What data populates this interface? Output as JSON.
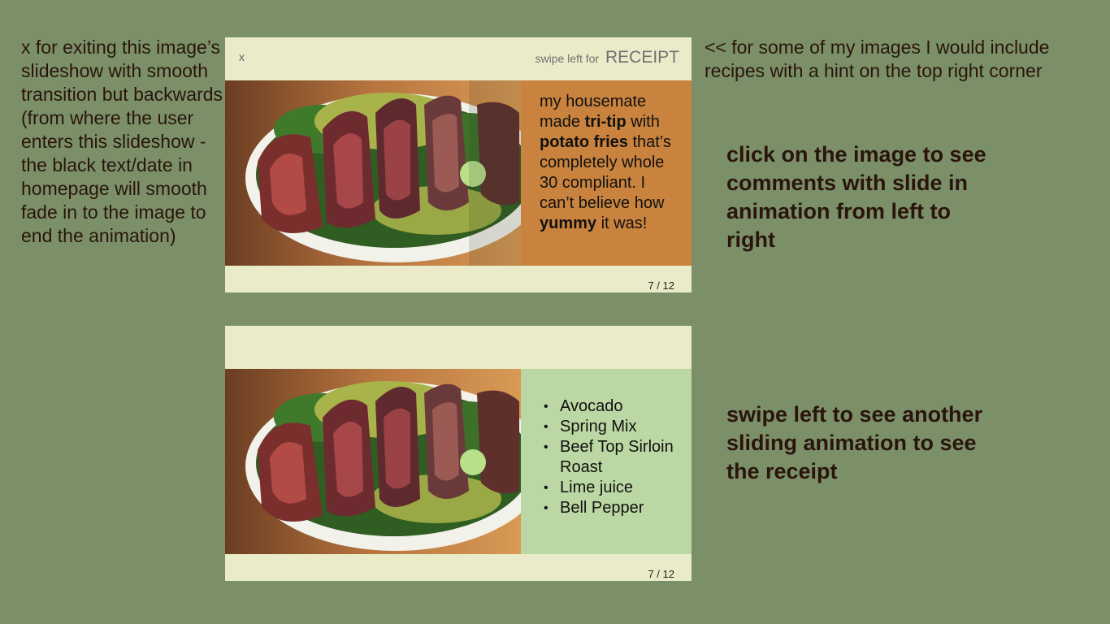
{
  "annotations": {
    "exit_note": "x for exiting this image’s slideshow with smooth transition but backwards (from where the user enters this slideshow - the black text/date in homepage will smooth fade in to the image to end the animation)",
    "recipe_hint_note": "<< for some of my images I would include recipes with a hint on the top right corner",
    "comments_note": "click on the image to see comments with slide in animation from left to right",
    "swipe_note": "swipe left to see another sliding animation to see the receipt"
  },
  "slide_comments": {
    "close_label": "x",
    "hint_prefix": "swipe left for",
    "hint_word": "RECEIPT",
    "comment": {
      "p1": "my housemate made ",
      "b1": "tri-tip",
      "p2": " with ",
      "b2": "potato fries",
      "p3": " that’s completely whole 30 compliant. I can’t believe how ",
      "b3": "yummy",
      "p4": " it was!"
    },
    "counter": "7 / 12"
  },
  "slide_recipe": {
    "ingredients": [
      "Avocado",
      "Spring Mix",
      "Beef Top Sirloin Roast",
      "Lime juice",
      "Bell Pepper"
    ],
    "bullet": "•",
    "counter": "7 / 12"
  },
  "colors": {
    "background": "#7b9068",
    "card": "#eaecc9",
    "comment_panel": "#c9833e",
    "recipe_panel": "#bbd7a3",
    "annotation_text": "#2a140d"
  },
  "icons": {
    "close": "close-icon (x glyph)"
  }
}
